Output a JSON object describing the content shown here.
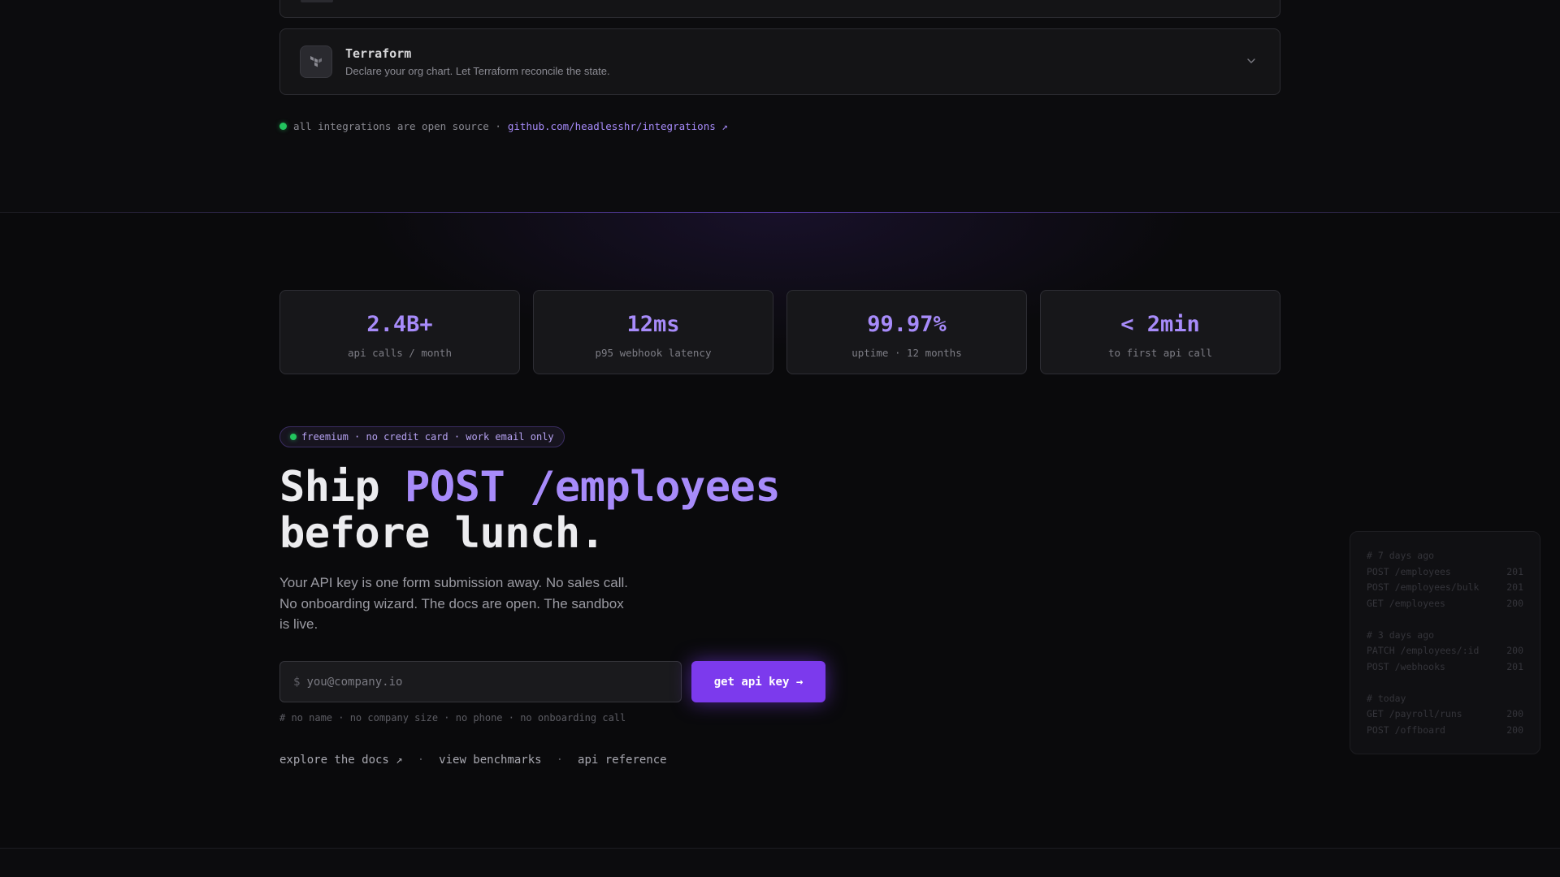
{
  "integrations": {
    "terraform": {
      "title": "Terraform",
      "description": "Declare your org chart. Let Terraform reconcile the state.",
      "icon": "terraform-logo-icon"
    },
    "open_source_note": "all integrations are open source ·",
    "repo_link": "github.com/headlesshr/integrations ↗"
  },
  "stats": [
    {
      "value": "2.4B+",
      "label": "api calls / month"
    },
    {
      "value": "12ms",
      "label": "p95 webhook latency"
    },
    {
      "value": "99.97%",
      "label": "uptime · 12 months"
    },
    {
      "value": "< 2min",
      "label": "to first api call"
    }
  ],
  "cta": {
    "badge": "freemium · no credit card · work email only",
    "headline_part1": "Ship ",
    "headline_accent": "POST /employees",
    "headline_part2": "before lunch.",
    "lead": "Your API key is one form submission away. No sales call. No onboarding wizard. The docs are open. The sandbox is live.",
    "input_prompt": "$",
    "input_placeholder": "you@company.io",
    "button_label": "get api key →",
    "note": "# no name · no company size · no phone · no onboarding call",
    "links": [
      "explore the docs ↗",
      "view benchmarks",
      "api reference"
    ],
    "link_separator": "·"
  },
  "log": {
    "groups": [
      {
        "header": "# 7 days ago",
        "rows": [
          {
            "req": "POST /employees",
            "code": "201"
          },
          {
            "req": "POST /employees/bulk",
            "code": "201"
          },
          {
            "req": "GET  /employees",
            "code": "200"
          }
        ]
      },
      {
        "header": "# 3 days ago",
        "rows": [
          {
            "req": "PATCH /employees/:id",
            "code": "200"
          },
          {
            "req": "POST /webhooks",
            "code": "201"
          }
        ]
      },
      {
        "header": "# today",
        "rows": [
          {
            "req": "GET  /payroll/runs",
            "code": "200"
          },
          {
            "req": "POST /offboard",
            "code": "200"
          }
        ]
      }
    ]
  },
  "colors": {
    "accent": "#a78bfa",
    "button": "#7c3aed",
    "status_dot": "#22c55e",
    "background": "#0c0c0e"
  }
}
